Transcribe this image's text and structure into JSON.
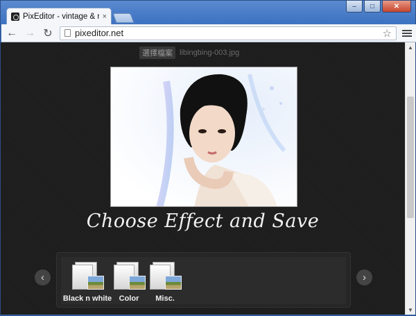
{
  "browser": {
    "tab_title": "PixEditor - vintage & retro",
    "tab_close": "×",
    "url": "pixeditor.net",
    "back": "←",
    "forward": "→",
    "reload": "↻",
    "bookmark": "☆",
    "window": {
      "minimize": "–",
      "maximize": "□",
      "close": "✕"
    }
  },
  "page": {
    "file_button": "選擇檔案",
    "file_name": "libingbing-003.jpg",
    "headline": "Choose Effect and Save",
    "prev_arrow": "‹",
    "next_arrow": "›",
    "effects": [
      {
        "label": "Black n white"
      },
      {
        "label": "Color"
      },
      {
        "label": "Misc."
      }
    ]
  },
  "scrollbar": {
    "up": "▲",
    "down": "▼"
  }
}
